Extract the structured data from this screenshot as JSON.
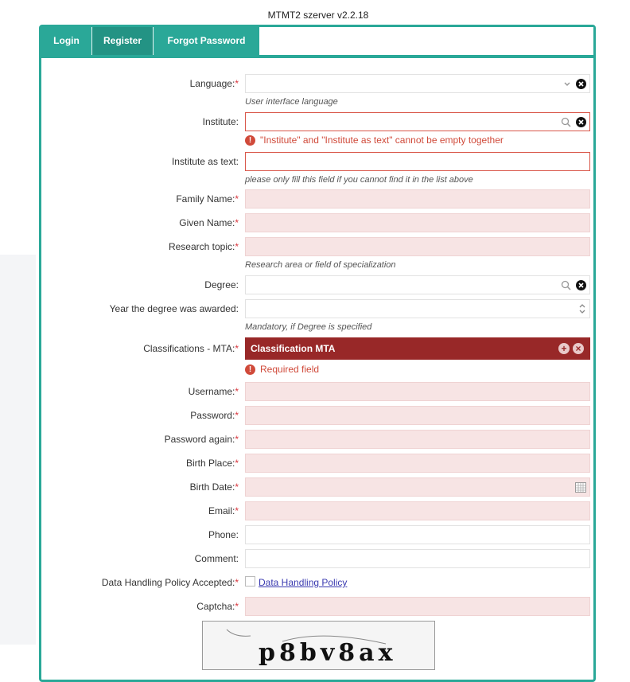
{
  "server_title": "MTMT2 szerver v2.2.18",
  "tabs": [
    {
      "label": "Login"
    },
    {
      "label": "Register"
    },
    {
      "label": "Forgot Password"
    }
  ],
  "form": {
    "language": {
      "label": "Language:",
      "hint": "User interface language"
    },
    "institute": {
      "label": "Institute:",
      "error": "\"Institute\" and \"Institute as text\" cannot be empty together"
    },
    "institute_text": {
      "label": "Institute as text:",
      "hint": "please only fill this field if you cannot find it in the list above"
    },
    "family_name": {
      "label": "Family Name:"
    },
    "given_name": {
      "label": "Given Name:"
    },
    "research_topic": {
      "label": "Research topic:",
      "hint": "Research area or field of specialization"
    },
    "degree": {
      "label": "Degree:"
    },
    "degree_year": {
      "label": "Year the degree was awarded:",
      "hint": "Mandatory, if Degree is specified"
    },
    "classifications": {
      "label": "Classifications - MTA:",
      "value": "Classification MTA",
      "error": "Required field"
    },
    "username": {
      "label": "Username:"
    },
    "password": {
      "label": "Password:"
    },
    "password_again": {
      "label": "Password again:"
    },
    "birth_place": {
      "label": "Birth Place:"
    },
    "birth_date": {
      "label": "Birth Date:"
    },
    "email": {
      "label": "Email:"
    },
    "phone": {
      "label": "Phone:"
    },
    "comment": {
      "label": "Comment:"
    },
    "policy": {
      "label": "Data Handling Policy Accepted:",
      "link": "Data Handling Policy"
    },
    "captcha": {
      "label": "Captcha:",
      "image_text": "p8bv8ax"
    }
  },
  "required_marker": "*",
  "error_icon_glyph": "!",
  "colors": {
    "accent": "#2aa898",
    "error": "#d04a3a",
    "classification_bg": "#982828",
    "required_bg": "#f7e4e4"
  }
}
